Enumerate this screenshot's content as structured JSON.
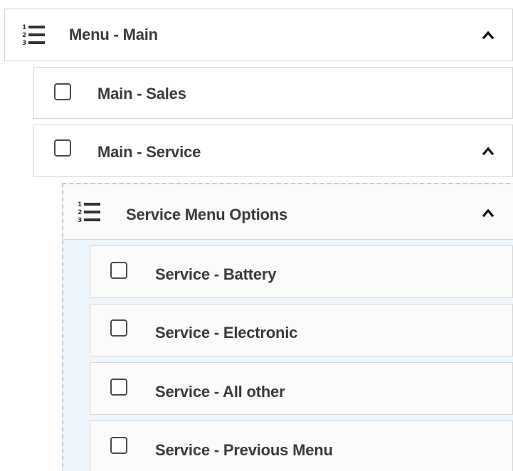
{
  "tree": {
    "root": {
      "label": "Menu - Main",
      "icon": "numbered-list-icon",
      "expanded": true
    },
    "children": [
      {
        "label": "Main - Sales",
        "checked": false,
        "has_chevron": false
      },
      {
        "label": "Main - Service",
        "checked": false,
        "has_chevron": true,
        "expanded": true
      }
    ],
    "service_group": {
      "label": "Service Menu Options",
      "icon": "numbered-list-icon",
      "expanded": true,
      "items": [
        {
          "label": "Service - Battery",
          "checked": false
        },
        {
          "label": "Service - Electronic",
          "checked": false
        },
        {
          "label": "Service - All other",
          "checked": false
        },
        {
          "label": "Service - Previous Menu",
          "checked": false
        }
      ]
    }
  },
  "colors": {
    "border": "#d6d6d6",
    "dashed_border": "#b9cfdc",
    "group_background": "#eef5fb",
    "text": "#3a3a3a"
  }
}
